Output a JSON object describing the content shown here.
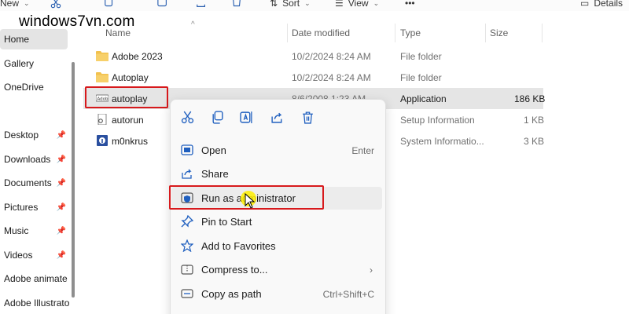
{
  "watermark": "windows7vn.com",
  "toolbar": {
    "new_label": "New",
    "sort_label": "Sort",
    "view_label": "View",
    "more_label": "•••",
    "details_label": "Details"
  },
  "sidebar": {
    "items": [
      {
        "label": "Home",
        "pinned": false,
        "active": true
      },
      {
        "label": "Gallery",
        "pinned": false
      },
      {
        "label": "OneDrive",
        "pinned": false
      },
      {
        "label": "Desktop",
        "pinned": true
      },
      {
        "label": "Downloads",
        "pinned": true
      },
      {
        "label": "Documents",
        "pinned": true
      },
      {
        "label": "Pictures",
        "pinned": true
      },
      {
        "label": "Music",
        "pinned": true
      },
      {
        "label": "Videos",
        "pinned": true
      },
      {
        "label": "Adobe animate",
        "pinned": false
      },
      {
        "label": "Adobe Illustrato",
        "pinned": false
      }
    ]
  },
  "columns": {
    "name": "Name",
    "date_modified": "Date modified",
    "type": "Type",
    "size": "Size"
  },
  "files": [
    {
      "name": "Adobe 2023",
      "date": "10/2/2024 8:24 AM",
      "type": "File folder",
      "size": "",
      "icon": "folder-icon"
    },
    {
      "name": "Autoplay",
      "date": "10/2/2024 8:24 AM",
      "type": "File folder",
      "size": "",
      "icon": "folder-icon"
    },
    {
      "name": "autoplay",
      "date": "8/6/2008 1:23 AM",
      "type": "Application",
      "size": "186 KB",
      "icon": "app-icon"
    },
    {
      "name": "autorun",
      "date": "",
      "type": "Setup Information",
      "size": "1 KB",
      "icon": "setup-file-icon"
    },
    {
      "name": "m0nkrus",
      "date": "",
      "type": "System Informatio...",
      "size": "3 KB",
      "icon": "sysinfo-icon"
    }
  ],
  "context_menu": {
    "quick_actions": [
      "cut-icon",
      "copy-icon",
      "rename-icon",
      "share-icon",
      "delete-icon"
    ],
    "items": [
      {
        "label": "Open",
        "shortcut": "Enter",
        "icon": "open-icon"
      },
      {
        "label": "Share",
        "shortcut": "",
        "icon": "share-icon"
      },
      {
        "label": "Run as administrator",
        "shortcut": "",
        "icon": "shield-icon"
      },
      {
        "label": "Pin to Start",
        "shortcut": "",
        "icon": "pin-icon"
      },
      {
        "label": "Add to Favorites",
        "shortcut": "",
        "icon": "star-icon"
      },
      {
        "label": "Compress to...",
        "shortcut": "",
        "icon": "zip-icon",
        "submenu": true
      },
      {
        "label": "Copy as path",
        "shortcut": "Ctrl+Shift+C",
        "icon": "copy-path-icon"
      }
    ],
    "submenu_arrow": "›"
  },
  "colors": {
    "highlight_border": "#d7191c",
    "folder": "#f2c14e",
    "accent": "#1f5fbf"
  }
}
